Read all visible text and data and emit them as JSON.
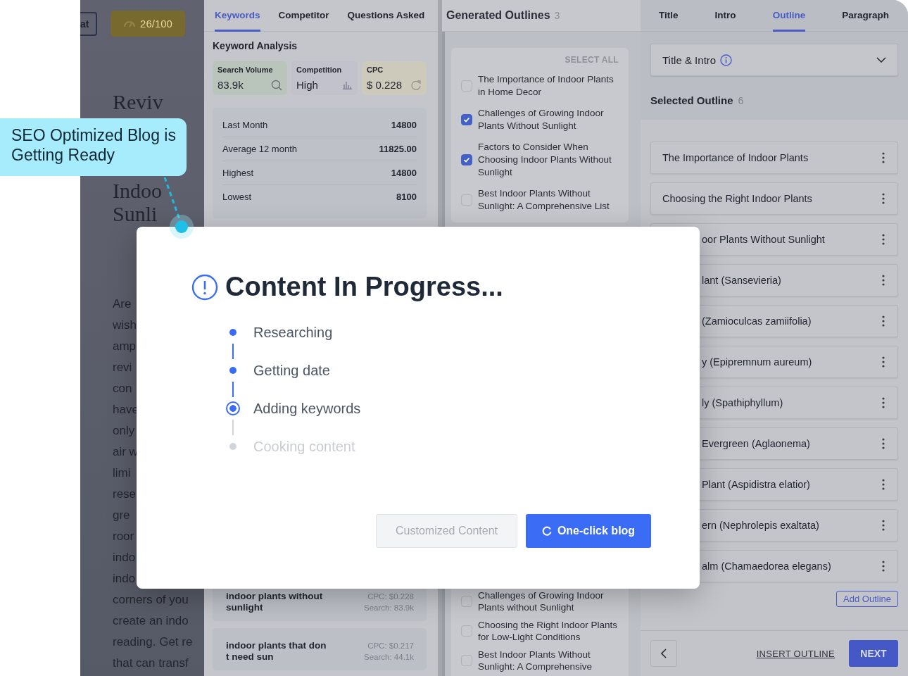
{
  "callout": {
    "text": "SEO Optimized Blog is Getting Ready"
  },
  "article": {
    "cut_button": "at",
    "score_button": "26/100",
    "heading_lines": [
      "Reviv",
      "Indoo",
      "Sunli"
    ],
    "body_lines": [
      "Are",
      "wish",
      "amp",
      "revi",
      "con",
      "have",
      "only",
      "air w",
      "limi",
      "rese",
      "gre",
      "roor",
      "indo",
      "indo",
      "corners of you",
      "create an indo",
      "reading. Get re",
      "that can transf"
    ]
  },
  "keywords_panel": {
    "tabs": [
      {
        "label": "Keywords",
        "selected": true
      },
      {
        "label": "Competitor",
        "selected": false
      },
      {
        "label": "Questions Asked",
        "selected": false
      }
    ],
    "title": "Keyword Analysis",
    "metrics": [
      {
        "label": "Search Volume",
        "value": "83.9k",
        "kind": "search",
        "color": "#b9c5bb"
      },
      {
        "label": "Competition",
        "value": "High",
        "kind": "chart",
        "color": "#c2c2cd"
      },
      {
        "label": "CPC",
        "value": "$ 0.228",
        "kind": "refresh",
        "color": "#cdc9bb"
      }
    ],
    "stats": [
      {
        "label": "Last Month",
        "value": "14800"
      },
      {
        "label": "Average 12 month",
        "value": "11825.00"
      },
      {
        "label": "Highest",
        "value": "14800"
      },
      {
        "label": "Lowest",
        "value": "8100"
      }
    ],
    "keywords": [
      {
        "text": "indoor plants without sunlight",
        "cpc": "CPC: $0.228",
        "search": "Search: 83.9k"
      },
      {
        "text": "indoor plants that don t need sun",
        "cpc": "CPC: $0.217",
        "search": "Search: 44.1k"
      }
    ]
  },
  "outlines_panel": {
    "title": "Generated Outlines",
    "count": "3",
    "select_all": "SELECT ALL",
    "items": [
      {
        "text": "The Importance of Indoor Plants in Home Decor",
        "checked": false
      },
      {
        "text": "Challenges of Growing Indoor Plants Without Sunlight",
        "checked": true
      },
      {
        "text": "Factors to Consider When Choosing Indoor Plants Without Sunlight",
        "checked": true
      },
      {
        "text": "Best Indoor Plants Without Sunlight: A Comprehensive List",
        "checked": false
      }
    ],
    "more_items": [
      {
        "text": "Challenges of Growing Indoor Plants without Sunlight",
        "checked": false
      },
      {
        "text": "Choosing the Right Indoor Plants for Low-Light Conditions",
        "checked": false
      },
      {
        "text": "Best Indoor Plants Without Sunlight: A Comprehensive",
        "checked": false
      }
    ]
  },
  "outline_panel": {
    "tabs": [
      {
        "label": "Title",
        "selected": false
      },
      {
        "label": "Intro",
        "selected": false
      },
      {
        "label": "Outline",
        "selected": true
      },
      {
        "label": "Paragraph",
        "selected": false
      }
    ],
    "dropdown": "Title & Intro",
    "selected_title": "Selected Outline",
    "selected_count": "6",
    "items": [
      "The Importance of Indoor Plants",
      "Choosing the Right Indoor Plants",
      "oor Plants Without Sunlight",
      "lant (Sansevieria)",
      "(Zamioculcas zamiifolia)",
      "y (Epipremnum aureum)",
      "ly (Spathiphyllum)",
      "Evergreen (Aglaonema)",
      "Plant (Aspidistra elatior)",
      "ern (Nephrolepis exaltata)",
      "alm (Chamaedorea elegans)"
    ],
    "add_button": "Add Outline",
    "insert_link": "INSERT OUTLINE",
    "next_button": "NEXT"
  },
  "modal": {
    "title": "Content In Progress...",
    "steps": [
      {
        "label": "Researching",
        "completed": true,
        "active": false
      },
      {
        "label": "Getting date",
        "completed": true,
        "active": false
      },
      {
        "label": "Adding keywords",
        "completed": false,
        "active": true
      },
      {
        "label": "Cooking content",
        "completed": false,
        "active": false
      }
    ],
    "buttons": [
      {
        "label": "Customized Content",
        "kind": "secondary"
      },
      {
        "label": "One-click blog",
        "kind": "primary"
      }
    ]
  }
}
